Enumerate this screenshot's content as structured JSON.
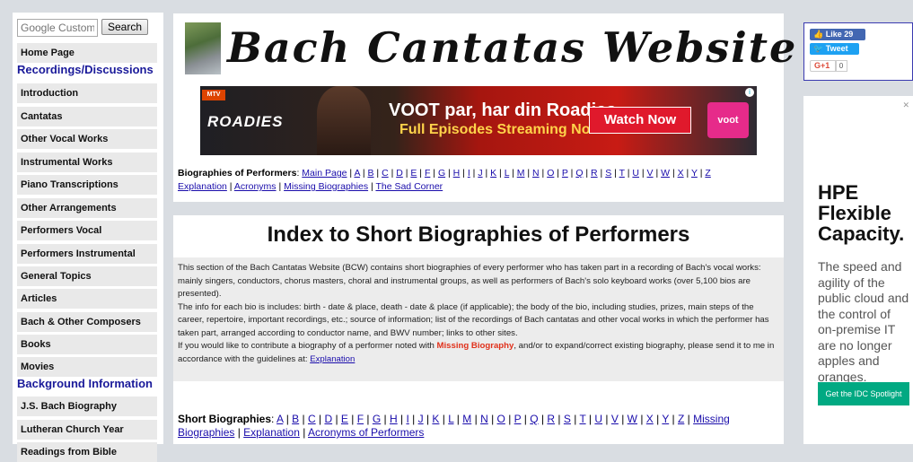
{
  "search": {
    "placeholder": "Google Custom",
    "button": "Search"
  },
  "sidebar": {
    "items": [
      {
        "label": "Home Page",
        "type": "link"
      },
      {
        "label": "Recordings/Discussions",
        "type": "section"
      },
      {
        "label": "Introduction",
        "type": "link"
      },
      {
        "label": "Cantatas",
        "type": "link"
      },
      {
        "label": "Other Vocal Works",
        "type": "link"
      },
      {
        "label": "Instrumental Works",
        "type": "link"
      },
      {
        "label": "Piano Transcriptions",
        "type": "link"
      },
      {
        "label": "Other Arrangements",
        "type": "link"
      },
      {
        "label": "Performers Vocal",
        "type": "link"
      },
      {
        "label": "Performers Instrumental",
        "type": "link"
      },
      {
        "label": "General Topics",
        "type": "link"
      },
      {
        "label": "Articles",
        "type": "link"
      },
      {
        "label": "Bach & Other Composers",
        "type": "link"
      },
      {
        "label": "Books",
        "type": "link"
      },
      {
        "label": "Movies",
        "type": "link"
      },
      {
        "label": "Background Information",
        "type": "section"
      },
      {
        "label": "J.S. Bach Biography",
        "type": "link"
      },
      {
        "label": "Lutheran Church Year",
        "type": "link"
      },
      {
        "label": "Readings from Bible",
        "type": "link"
      }
    ]
  },
  "header": {
    "title": "Bach Cantatas Website",
    "logo_icon": "bach-statue-photo"
  },
  "ad_banner": {
    "tag": "MTV",
    "show": "ROADIES",
    "line1": "VOOT par, har din Roadies",
    "line2": "Full Episodes Streaming Now",
    "cta": "Watch Now",
    "brand": "voot",
    "info": "i"
  },
  "bio_nav": {
    "label": "Biographies of Performers",
    "main_page": "Main Page",
    "letters": [
      "A",
      "B",
      "C",
      "D",
      "E",
      "F",
      "G",
      "H",
      "I",
      "J",
      "K",
      "L",
      "M",
      "N",
      "O",
      "P",
      "Q",
      "R",
      "S",
      "T",
      "U",
      "V",
      "W",
      "X",
      "Y",
      "Z"
    ],
    "extra": [
      "Explanation",
      "Acronyms",
      "Missing Biographies",
      "The Sad Corner"
    ]
  },
  "content": {
    "title": "Index to Short Biographies of Performers",
    "intro_p1": "This section of the Bach Cantatas Website (BCW) contains short biographies of every performer who has taken part in a recording of Bach's vocal works: mainly singers, conductors, chorus masters, choral and instrumental groups, as well as performers of Bach's solo keyboard works (over 5,100 bios are presented).",
    "intro_p2": "The info for each bio is includes: birth - date & place, death - date & place (if applicable); the body of the bio, including studies, prizes, main steps of the career, repertoire, important recordings, etc.; source of information; list of the recordings of Bach cantatas and other vocal works in which the performer has taken part, arranged according to conductor name, and BWV number; links to other sites.",
    "intro_p3_a": "If you would like to contribute a biography of a performer noted with",
    "intro_p3_missing": "Missing Biography",
    "intro_p3_b": ", and/or to expand/correct existing biography, please send it to me in accordance with the guidelines at:",
    "intro_p3_link": "Explanation"
  },
  "short_bios": {
    "label": "Short Biographies",
    "letters": [
      "A",
      "B",
      "C",
      "D",
      "E",
      "F",
      "G",
      "H",
      "I",
      "J",
      "K",
      "L",
      "M",
      "N",
      "O",
      "P",
      "Q",
      "R",
      "S",
      "T",
      "U",
      "V",
      "W",
      "X",
      "Y",
      "Z"
    ],
    "extra": [
      "Missing Biographies",
      "Explanation",
      "Acronyms of Performers"
    ]
  },
  "social": {
    "fb": "Like 29",
    "tw": "Tweet",
    "gp": "G+1",
    "gp_count": "0"
  },
  "side_ad": {
    "close": "✕",
    "headline": "HPE Flexible Capacity.",
    "body": "The speed and agility of the public cloud and the control of on-premise IT are no longer apples and oranges.",
    "cta": "Get the IDC Spotlight",
    "accent": "#01a982"
  }
}
